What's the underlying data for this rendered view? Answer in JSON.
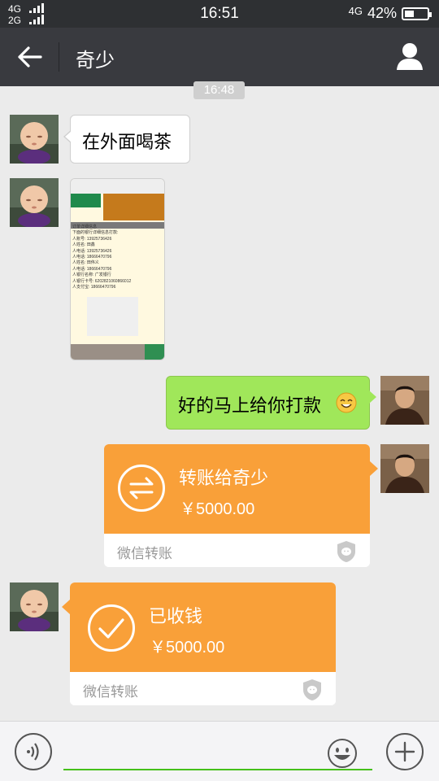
{
  "status_bar": {
    "network_1": "4G",
    "network_2": "2G",
    "time": "16:51",
    "right_network": "4G",
    "battery_text": "42%",
    "battery_level": 0.42
  },
  "title_bar": {
    "title": "奇少",
    "back_icon": "arrow-left-icon",
    "profile_icon": "person-icon"
  },
  "timestamp": "16:48",
  "messages": {
    "m1_text": "在外面喝茶",
    "m3_text": "好的马上给你打款",
    "m3_emoji": "smile-emoji-icon",
    "m4": {
      "title": "转账给奇少",
      "amount": "￥5000.00",
      "footer": "微信转账",
      "icon": "transfer-arrows-icon"
    },
    "m5": {
      "title": "已收钱",
      "amount": "￥5000.00",
      "footer": "微信转账",
      "icon": "checkmark-icon"
    }
  },
  "thumbnail_lines": [
    "订单详细信息",
    "下面的银行详细信息打款:",
    "人账号: 13925736426",
    "人姓名: 田鑫",
    "人电话: 13925736426",
    "人电话: 18666470796",
    "人姓名: 田伟义",
    "人电话: 18666470796",
    "人银行名称: 广发银行",
    "人银行卡号: 6202821060866012",
    "人支付宝: 18666470796"
  ],
  "input_bar": {
    "placeholder": "",
    "voice_icon": "voice-icon",
    "emoji_icon": "emoji-icon",
    "plus_icon": "plus-icon"
  },
  "colors": {
    "transfer_orange": "#f9a039",
    "sent_green": "#a0e75a",
    "titlebar": "#393a3f",
    "input_accent": "#45c01a"
  }
}
